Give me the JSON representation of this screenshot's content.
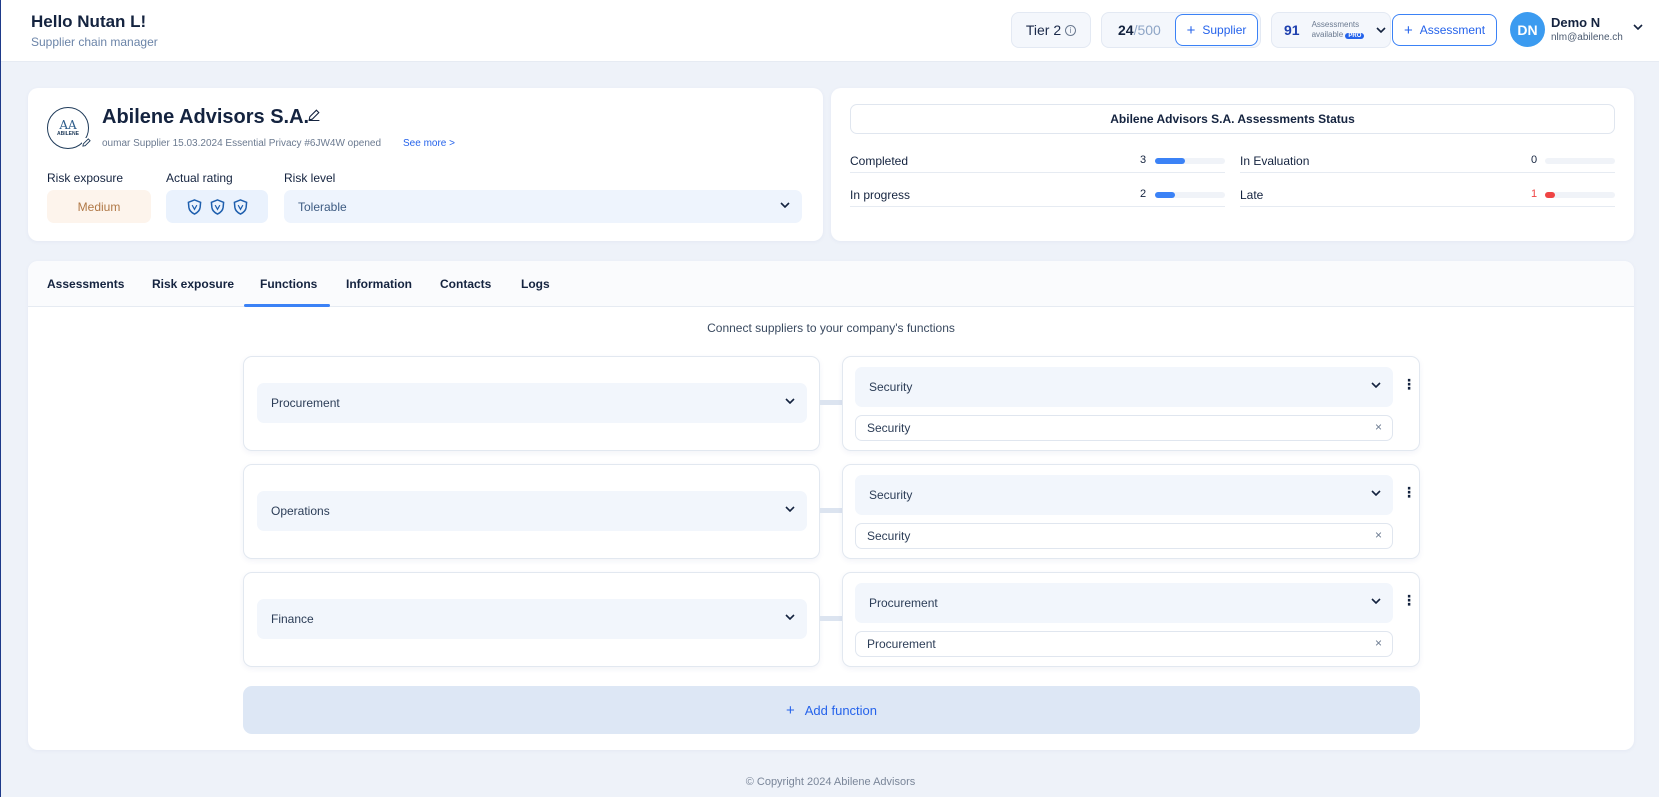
{
  "header": {
    "greeting": "Hello Nutan L!",
    "role": "Supplier chain manager",
    "tier": "Tier 2",
    "supplier_used": "24",
    "supplier_total": "/500",
    "add_supplier_label": "Supplier",
    "assessments_available_count": "91",
    "assessments_available_label_1": "Assessments",
    "assessments_available_label_2": "available",
    "pro_badge": "PRO",
    "add_assessment_label": "Assessment",
    "user_initials": "DN",
    "user_name": "Demo N",
    "user_email": "nlm@abilene.ch"
  },
  "supplier": {
    "logo_text": "AA",
    "logo_subtext": "ABILENE",
    "name": "Abilene Advisors S.A.",
    "meta": "oumar Supplier 15.03.2024 Essential Privacy #6JW4W opened",
    "see_more": "See more >",
    "risk_exposure_label": "Risk exposure",
    "risk_exposure_value": "Medium",
    "actual_rating_label": "Actual rating",
    "rating_count": 3,
    "risk_level_label": "Risk level",
    "risk_level_value": "Tolerable"
  },
  "status": {
    "title": "Abilene Advisors S.A. Assessments Status",
    "items": [
      {
        "label": "Completed",
        "value": "3",
        "fraction": 0.43,
        "color": "#3b82f6"
      },
      {
        "label": "In progress",
        "value": "2",
        "fraction": 0.28,
        "color": "#3b82f6"
      },
      {
        "label": "In Evaluation",
        "value": "0",
        "fraction": 0,
        "color": "#3b82f6"
      },
      {
        "label": "Late",
        "value": "1",
        "fraction": 0.14,
        "color": "#ef4444"
      }
    ]
  },
  "tabs": [
    "Assessments",
    "Risk exposure",
    "Functions",
    "Information",
    "Contacts",
    "Logs"
  ],
  "active_tab": "Functions",
  "functions": {
    "subtitle": "Connect suppliers to your company's functions",
    "rows": [
      {
        "function": "Procurement",
        "department": "Security",
        "tag": "Security"
      },
      {
        "function": "Operations",
        "department": "Security",
        "tag": "Security"
      },
      {
        "function": "Finance",
        "department": "Procurement",
        "tag": "Procurement"
      }
    ],
    "add_label": "Add function"
  },
  "footer": "© Copyright 2024 Abilene Advisors",
  "colors": {
    "accent": "#3b82f6",
    "late": "#ef4444",
    "medium_bg": "#fdf4ec",
    "medium_text": "#b07846"
  }
}
